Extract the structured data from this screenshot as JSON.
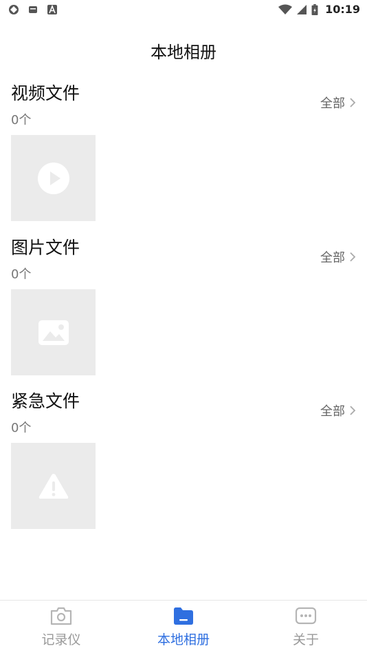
{
  "status_bar": {
    "time": "10:19",
    "icons_left": [
      "globe-icon",
      "message-icon",
      "font-a-icon"
    ],
    "icons_right": [
      "wifi-icon",
      "signal-icon",
      "battery-icon"
    ]
  },
  "header": {
    "title": "本地相册"
  },
  "sections": [
    {
      "title": "视频文件",
      "count": "0个",
      "all_label": "全部",
      "thumb_icon": "play-icon"
    },
    {
      "title": "图片文件",
      "count": "0个",
      "all_label": "全部",
      "thumb_icon": "image-icon"
    },
    {
      "title": "紧急文件",
      "count": "0个",
      "all_label": "全部",
      "thumb_icon": "warning-icon"
    }
  ],
  "bottom_nav": {
    "items": [
      {
        "label": "记录仪",
        "icon": "camera-icon",
        "active": false
      },
      {
        "label": "本地相册",
        "icon": "folder-icon",
        "active": true
      },
      {
        "label": "关于",
        "icon": "more-icon",
        "active": false
      }
    ]
  },
  "colors": {
    "accent": "#2f6fe0",
    "inactive": "#999999",
    "placeholder": "#ebebeb"
  }
}
